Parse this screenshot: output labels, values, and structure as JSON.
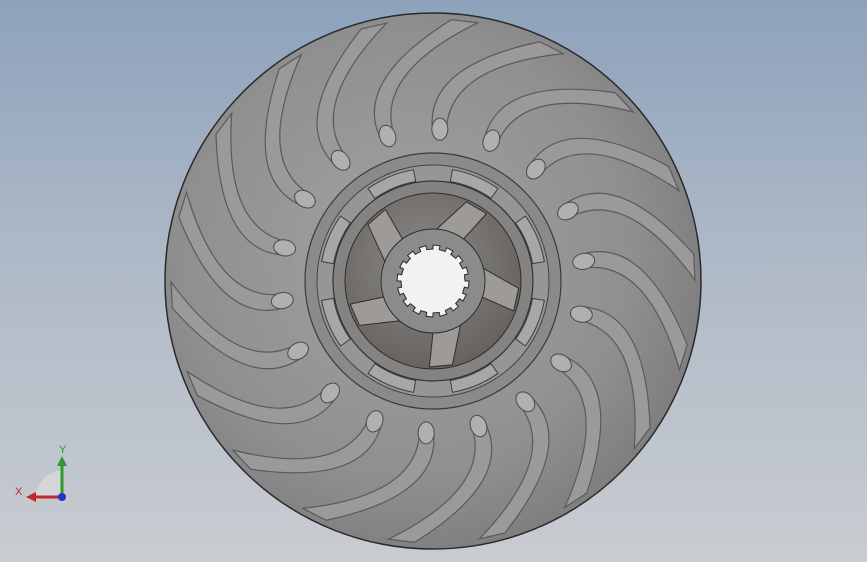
{
  "viewport": {
    "background_top": "#8da2bc",
    "background_bottom": "#c9ccd1"
  },
  "model": {
    "blade_count": 18,
    "spline_teeth": 16,
    "drive_lugs": 5,
    "colors": {
      "body": "#8e8e8e",
      "blade_face": "#9a9a9a",
      "blade_edge": "#5a5a5a",
      "hub": "#7f7f7f",
      "hub_dark": "#6e6a66",
      "bore": "#f2f2f2",
      "outline": "#2a2a2a"
    }
  },
  "triad": {
    "x_label": "X",
    "y_label": "Y",
    "x_color": "#c0262c",
    "y_color": "#2c9a2c",
    "z_color": "#2233cc"
  }
}
